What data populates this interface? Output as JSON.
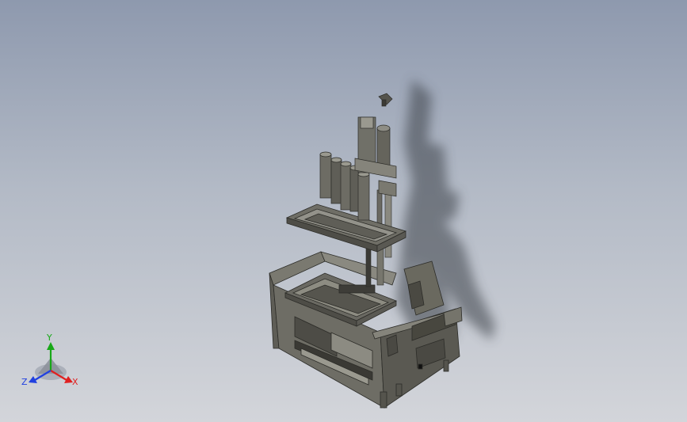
{
  "viewport": {
    "background_top": "#8e99ae",
    "background_bottom": "#d3d5da",
    "model_color": "#5f5e58",
    "shadow_color": "#3b3f47"
  },
  "triad": {
    "x_label": "X",
    "y_label": "Y",
    "z_label": "Z",
    "x_color": "#e02020",
    "y_color": "#18a818",
    "z_color": "#2040e0"
  }
}
